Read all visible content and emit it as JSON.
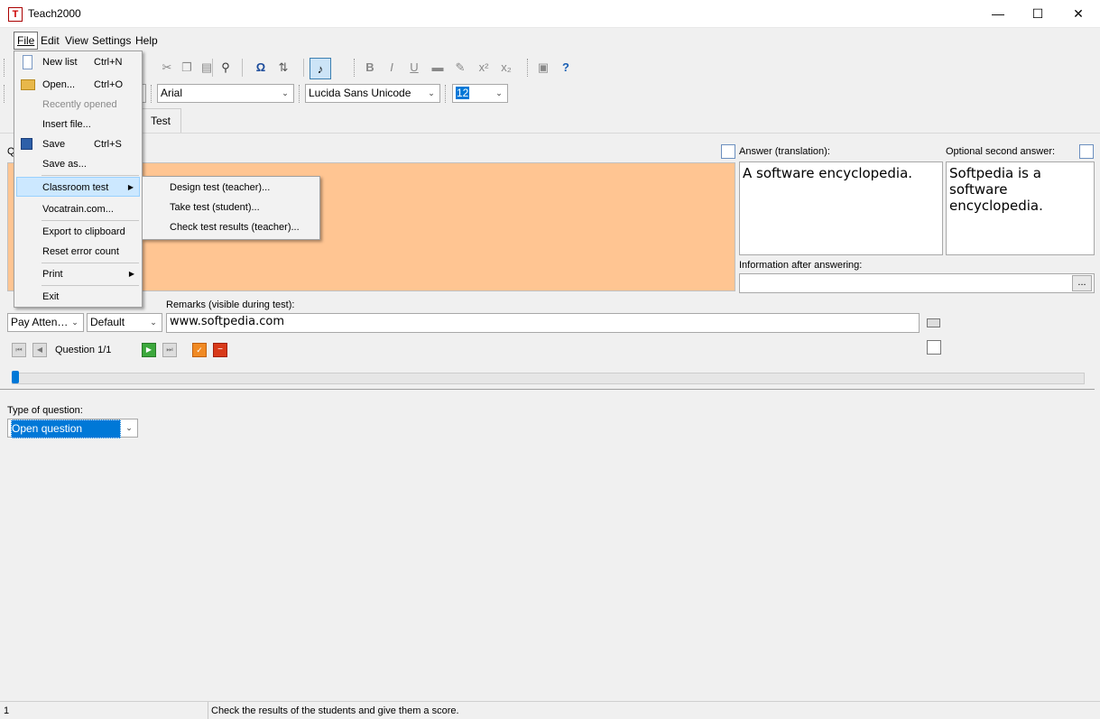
{
  "window": {
    "title": "Teach2000",
    "app_icon_letter": "T",
    "minimize": "—",
    "maximize": "☐",
    "close": "✕"
  },
  "menubar": {
    "items": [
      "File",
      "Edit",
      "View",
      "Settings",
      "Help"
    ]
  },
  "toolbar": {
    "font_name": "Arial",
    "font_name_2": "Lucida Sans Unicode",
    "font_size": "12"
  },
  "tabs": {
    "active": "Test"
  },
  "fields": {
    "question_label": "Q",
    "answer_label": "Answer (translation):",
    "answer_value": "A software encyclopedia.",
    "second_answer_label": "Optional second answer:",
    "second_answer_value": "Softpedia is a software encyclopedia.",
    "info_label": "Information after answering:",
    "info_button": "...",
    "remarks_label": "Remarks (visible during test):",
    "remarks_value": "www.softpedia.com",
    "combo1_value": "Pay Atten…",
    "combo2_value": "Default",
    "question_counter": "Question 1/1",
    "type_label": "Type of question:",
    "type_value": "Open question"
  },
  "file_menu": {
    "items": [
      {
        "label": "New list",
        "shortcut": "Ctrl+N"
      },
      {
        "label": "Open...",
        "shortcut": "Ctrl+O"
      },
      {
        "label": "Recently opened",
        "shortcut": ""
      },
      {
        "label": "Insert file...",
        "shortcut": ""
      },
      {
        "label": "Save",
        "shortcut": "Ctrl+S"
      },
      {
        "label": "Save as...",
        "shortcut": ""
      },
      {
        "label": "Classroom test",
        "shortcut": ""
      },
      {
        "label": "Vocatrain.com...",
        "shortcut": ""
      },
      {
        "label": "Export to clipboard",
        "shortcut": ""
      },
      {
        "label": "Reset error count",
        "shortcut": ""
      },
      {
        "label": "Print",
        "shortcut": ""
      },
      {
        "label": "Exit",
        "shortcut": ""
      }
    ]
  },
  "classroom_submenu": {
    "items": [
      "Design test (teacher)...",
      "Take test (student)...",
      "Check test results (teacher)..."
    ]
  },
  "statusbar": {
    "panel1": "1",
    "message": "Check the results of the students and give them a score."
  },
  "colors": {
    "question_bg": "#ffc592",
    "selection": "#cce8ff",
    "accent": "#0078d7"
  }
}
